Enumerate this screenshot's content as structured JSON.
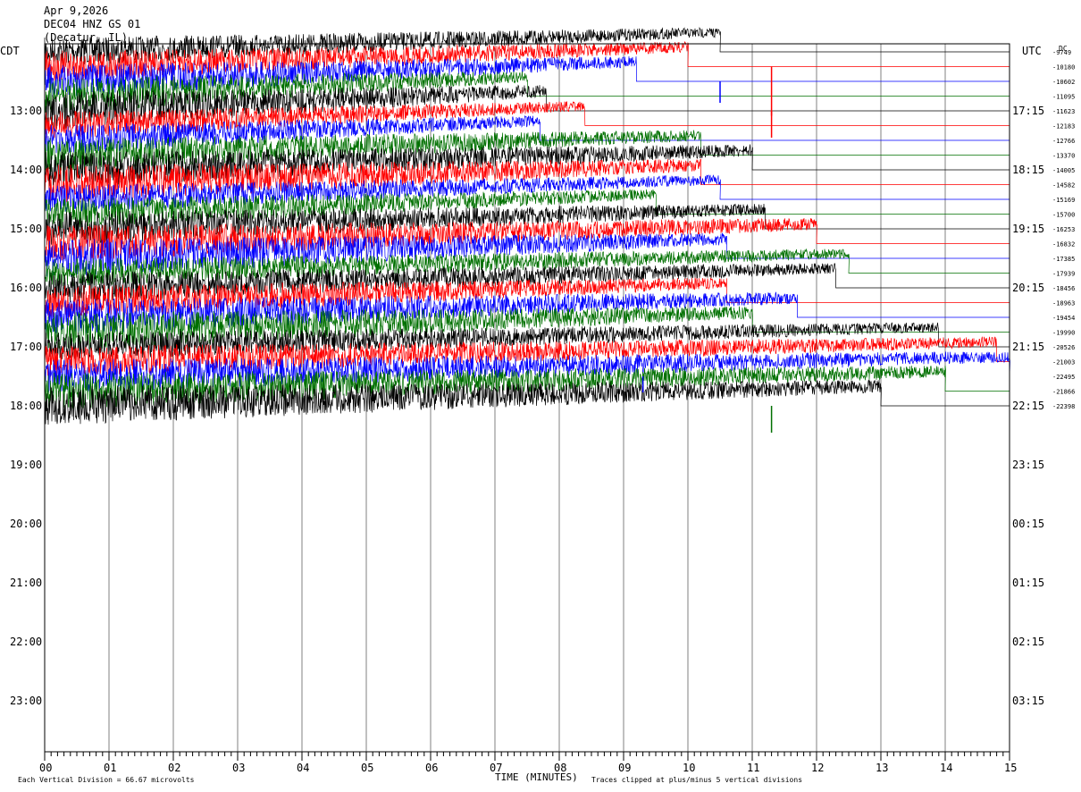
{
  "header": {
    "date": "Apr 9,2026",
    "station": "DEC04 HNZ GS 01",
    "location": "(Decatur, IL)"
  },
  "labels": {
    "left_timezone": "CDT",
    "right_timezone": "UTC",
    "dc_label": "DC",
    "footer_left": "Each Vertical Division =   66.67 microvolts",
    "footer_right": "Traces clipped at plus/minus 5 vertical divisions"
  },
  "colors": {
    "trace_cycle": [
      "#000000",
      "#ff0000",
      "#0000ff",
      "#007000"
    ],
    "grid": "#808080",
    "frame": "#000000"
  },
  "chart_data": {
    "type": "line",
    "xlabel": "TIME (MINUTES)",
    "xlim": [
      0,
      15
    ],
    "x_ticks": [
      "00",
      "01",
      "02",
      "03",
      "04",
      "05",
      "06",
      "07",
      "08",
      "09",
      "10",
      "11",
      "12",
      "13",
      "14",
      "15"
    ],
    "rows_per_hour": 4,
    "left_hour_labels": [
      "13:00",
      "14:00",
      "15:00",
      "16:00",
      "17:00",
      "18:00",
      "19:00",
      "20:00",
      "21:00",
      "22:00",
      "23:00"
    ],
    "right_hour_labels": [
      "17:15",
      "18:15",
      "19:15",
      "20:15",
      "21:15",
      "22:15",
      "23:15",
      "00:15",
      "01:15",
      "02:15",
      "03:15"
    ],
    "dc_offsets": [
      "-9749",
      "-10180",
      "-10602",
      "-11095",
      "-11623",
      "-12183",
      "-12766",
      "-13370",
      "-14005",
      "-14582",
      "-15169",
      "-15700",
      "-16253",
      "-16832",
      "-17385",
      "-17939",
      "-18456",
      "-18963",
      "-19454",
      "-19990",
      "-20526",
      "-21003",
      "-22495",
      "-21866",
      "-22398"
    ],
    "trace_end_minutes": [
      10.5,
      10.0,
      9.2,
      7.5,
      7.8,
      8.4,
      7.7,
      10.2,
      11.0,
      10.2,
      10.5,
      9.5,
      11.2,
      12.0,
      10.6,
      12.5,
      12.3,
      10.6,
      11.7,
      11.0,
      13.9,
      14.8,
      15.0,
      14.0,
      13.0
    ]
  }
}
